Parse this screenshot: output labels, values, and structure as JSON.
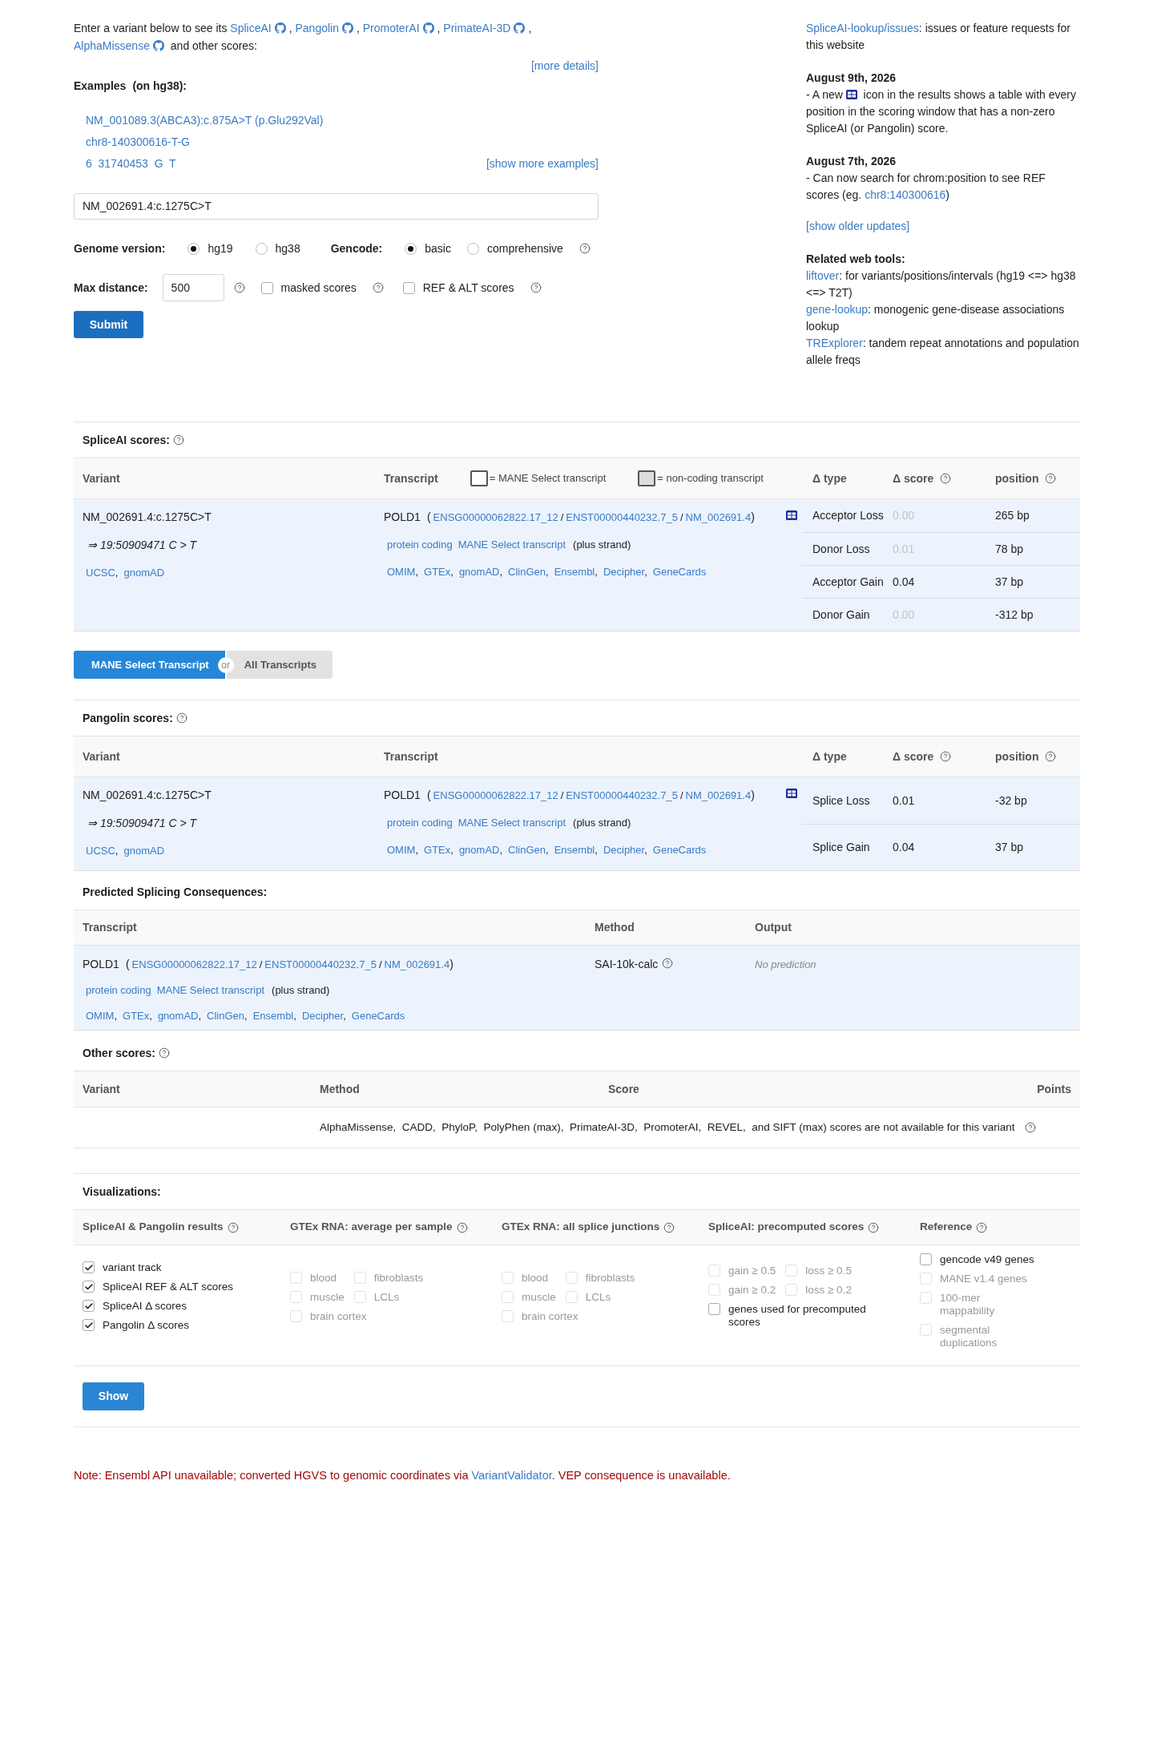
{
  "punct": {
    "comma": ",",
    "slash": "/",
    "open": "(",
    "close": ")"
  },
  "intro": {
    "lead": "Enter a variant below to see its",
    "tools": [
      "SpliceAI",
      "Pangolin",
      "PromoterAI",
      "PrimateAI-3D",
      "AlphaMissense"
    ],
    "tail": "and other scores:"
  },
  "more_details": "[more details]",
  "examples": {
    "title": "Examples",
    "note": "(on hg38):",
    "items": [
      "NM_001089.3(ABCA3):c.875A>T (p.Glu292Val)",
      "chr8-140300616-T-G",
      "6  31740453  G  T"
    ],
    "more": "[show more examples]"
  },
  "search": {
    "value": "NM_002691.4:c.1275C>T"
  },
  "genome": {
    "label": "Genome version:",
    "options": [
      {
        "label": "hg19",
        "selected": true
      },
      {
        "label": "hg38",
        "selected": false
      }
    ]
  },
  "gencode": {
    "label": "Gencode:",
    "options": [
      {
        "label": "basic",
        "selected": true
      },
      {
        "label": "comprehensive",
        "selected": false
      }
    ]
  },
  "max_distance": {
    "label": "Max distance:",
    "value": "500"
  },
  "options": [
    {
      "label": "masked scores",
      "checked": false
    },
    {
      "label": "REF & ALT scores",
      "checked": false
    }
  ],
  "submit": "Submit",
  "news": {
    "issues_link": "SpliceAI-lookup/issues",
    "issues_text": ": issues or feature requests for this website",
    "updates": [
      {
        "date": "August 9th, 2026",
        "parts": [
          {
            "kind": "text",
            "text": "- A new "
          },
          {
            "kind": "icon"
          },
          {
            "kind": "text",
            "text": "  icon in the results shows a table with every position in the scoring window that has a non-zero SpliceAI (or Pangolin) score."
          }
        ]
      },
      {
        "date": "August 7th, 2026",
        "parts": [
          {
            "kind": "text",
            "text": "- Can now search for chrom:position to see REF scores (eg. "
          },
          {
            "kind": "link",
            "text": "chr8:140300616"
          },
          {
            "kind": "text",
            "text": ")"
          }
        ]
      }
    ],
    "older": "[show older updates]",
    "related_title": "Related web tools:",
    "related": [
      {
        "link": "liftover",
        "text": ": for variants/positions/intervals (hg19 <=> hg38 <=> T2T)"
      },
      {
        "link": "gene-lookup",
        "text": ": monogenic gene-disease associations lookup"
      },
      {
        "link": "TRExplorer",
        "text": ": tandem repeat annotations and population allele freqs"
      }
    ]
  },
  "spliceai": {
    "title": "SpliceAI scores:",
    "headers": {
      "variant": "Variant",
      "transcript": "Transcript",
      "type": "Δ type",
      "score": "Δ score",
      "position": "position"
    },
    "legend": [
      {
        "kind": "mane",
        "label": "= MANE Select transcript"
      },
      {
        "kind": "noncoding",
        "label": "= non-coding transcript"
      }
    ],
    "variant": {
      "name": "NM_002691.4:c.1275C>T",
      "coords": "⇒ 19:50909471 C > T",
      "links": [
        "UCSC",
        "gnomAD"
      ]
    },
    "transcript": {
      "gene": "POLD1",
      "ids": [
        "ENSG00000062822.17_12",
        "ENST00000440232.7_5",
        "NM_002691.4"
      ],
      "tags": [
        "protein coding",
        "MANE Select transcript"
      ],
      "strand": "(plus strand)",
      "links": [
        "OMIM",
        "GTEx",
        "gnomAD",
        "ClinGen",
        "Ensembl",
        "Decipher",
        "GeneCards"
      ]
    },
    "scores": [
      {
        "type": "Acceptor Loss",
        "score": "0.00",
        "dimmed": true,
        "position": "265 bp"
      },
      {
        "type": "Donor Loss",
        "score": "0.01",
        "dimmed": true,
        "position": "78 bp"
      },
      {
        "type": "Acceptor Gain",
        "score": "0.04",
        "dimmed": false,
        "position": "37 bp"
      },
      {
        "type": "Donor Gain",
        "score": "0.00",
        "dimmed": true,
        "position": "-312 bp"
      }
    ]
  },
  "view_toggle": {
    "or": "or",
    "options": [
      {
        "label": "MANE Select Transcript",
        "selected": true
      },
      {
        "label": "All Transcripts",
        "selected": false
      }
    ]
  },
  "pangolin": {
    "title": "Pangolin scores:",
    "headers": {
      "variant": "Variant",
      "transcript": "Transcript",
      "type": "Δ type",
      "score": "Δ score",
      "position": "position"
    },
    "variant": {
      "name": "NM_002691.4:c.1275C>T",
      "coords": "⇒ 19:50909471 C > T",
      "links": [
        "UCSC",
        "gnomAD"
      ]
    },
    "transcript": {
      "gene": "POLD1",
      "ids": [
        "ENSG00000062822.17_12",
        "ENST00000440232.7_5",
        "NM_002691.4"
      ],
      "tags": [
        "protein coding",
        "MANE Select transcript"
      ],
      "strand": "(plus strand)",
      "links": [
        "OMIM",
        "GTEx",
        "gnomAD",
        "ClinGen",
        "Ensembl",
        "Decipher",
        "GeneCards"
      ]
    },
    "scores": [
      {
        "type": "Splice Loss",
        "score": "0.01",
        "dimmed": false,
        "position": "-32 bp"
      },
      {
        "type": "Splice Gain",
        "score": "0.04",
        "dimmed": false,
        "position": "37 bp"
      }
    ]
  },
  "consequences": {
    "title": "Predicted Splicing Consequences:",
    "headers": [
      "Transcript",
      "Method",
      "Output"
    ],
    "transcript": {
      "gene": "POLD1",
      "ids": [
        "ENSG00000062822.17_12",
        "ENST00000440232.7_5",
        "NM_002691.4"
      ],
      "tags": [
        "protein coding",
        "MANE Select transcript"
      ],
      "strand": "(plus strand)",
      "links": [
        "OMIM",
        "GTEx",
        "gnomAD",
        "ClinGen",
        "Ensembl",
        "Decipher",
        "GeneCards"
      ]
    },
    "method": "SAI-10k-calc",
    "output": "No prediction"
  },
  "other": {
    "title": "Other scores:",
    "headers": [
      "Variant",
      "Method",
      "Score",
      "Points"
    ],
    "message": "AlphaMissense,  CADD,  PhyloP,  PolyPhen (max),  PrimateAI-3D,  PromoterAI,  REVEL,  and SIFT (max) scores are not available for this variant"
  },
  "visualizations": {
    "title": "Visualizations:",
    "groups": [
      {
        "title": "SpliceAI & Pangolin results",
        "items": [
          {
            "label": "variant track",
            "checked": true,
            "disabled": false
          },
          {
            "label": "SpliceAI REF & ALT scores",
            "checked": true,
            "disabled": false
          },
          {
            "label": "SpliceAI Δ scores",
            "checked": true,
            "disabled": false
          },
          {
            "label": "Pangolin Δ  scores",
            "checked": true,
            "disabled": false
          }
        ]
      },
      {
        "title": "GTEx RNA: average per sample",
        "items": [
          {
            "label": "blood",
            "checked": false,
            "disabled": true
          },
          {
            "label": "fibroblasts",
            "checked": false,
            "disabled": true
          },
          {
            "label": "muscle",
            "checked": false,
            "disabled": true
          },
          {
            "label": "LCLs",
            "checked": false,
            "disabled": true
          },
          {
            "label": "brain cortex",
            "checked": false,
            "disabled": true
          }
        ]
      },
      {
        "title": "GTEx RNA: all splice junctions",
        "items": [
          {
            "label": "blood",
            "checked": false,
            "disabled": true
          },
          {
            "label": "fibroblasts",
            "checked": false,
            "disabled": true
          },
          {
            "label": "muscle",
            "checked": false,
            "disabled": true
          },
          {
            "label": "LCLs",
            "checked": false,
            "disabled": true
          },
          {
            "label": "brain cortex",
            "checked": false,
            "disabled": true
          }
        ]
      },
      {
        "title": "SpliceAI: precomputed scores",
        "items": [
          {
            "label": "gain ≥ 0.5",
            "checked": false,
            "disabled": true
          },
          {
            "label": "loss ≥ 0.5",
            "checked": false,
            "disabled": true
          },
          {
            "label": "gain ≥ 0.2",
            "checked": false,
            "disabled": true
          },
          {
            "label": "loss ≥ 0.2",
            "checked": false,
            "disabled": true
          },
          {
            "label": "genes used for precomputed scores",
            "checked": false,
            "disabled": false
          }
        ]
      },
      {
        "title": "Reference",
        "items": [
          {
            "label": "gencode v49 genes",
            "checked": false,
            "disabled": false
          },
          {
            "label": "MANE v1.4 genes",
            "checked": false,
            "disabled": true
          },
          {
            "label": "100-mer mappability",
            "checked": false,
            "disabled": true
          },
          {
            "label": "segmental duplications",
            "checked": false,
            "disabled": true
          }
        ]
      }
    ],
    "show": "Show"
  },
  "note": {
    "before": "Note: Ensembl API unavailable; converted HGVS to genomic coordinates via ",
    "link": "VariantValidator",
    "after": ". VEP consequence is unavailable."
  }
}
